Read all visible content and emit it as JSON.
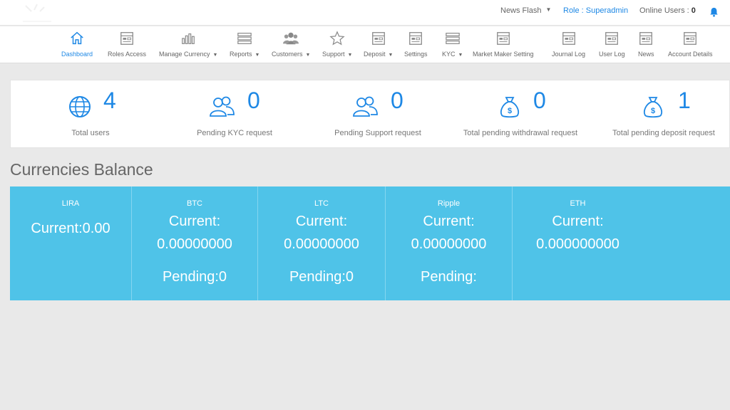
{
  "topbar": {
    "news_flash": "News Flash",
    "role": "Role : Superadmin",
    "online_label": "Online Users : ",
    "online_count": "0"
  },
  "nav": [
    {
      "label": "Dashboard",
      "icon": "home-icon",
      "dropdown": false,
      "active": true
    },
    {
      "label": "Roles Access",
      "icon": "panel-icon",
      "dropdown": false
    },
    {
      "label": "Manage Currency",
      "icon": "bar-chart-icon",
      "dropdown": true
    },
    {
      "label": "Reports",
      "icon": "list-icon",
      "dropdown": true
    },
    {
      "label": "Customers",
      "icon": "users-icon",
      "dropdown": true
    },
    {
      "label": "Support",
      "icon": "star-icon",
      "dropdown": true
    },
    {
      "label": "Deposit",
      "icon": "panel-icon",
      "dropdown": true
    },
    {
      "label": "Settings",
      "icon": "panel-icon",
      "dropdown": false
    },
    {
      "label": "KYC",
      "icon": "list-icon",
      "dropdown": true
    },
    {
      "label": "Market Maker Setting",
      "icon": "panel-icon",
      "dropdown": false
    },
    {
      "label": "Journal Log",
      "icon": "panel-icon",
      "dropdown": false
    },
    {
      "label": "User Log",
      "icon": "panel-icon",
      "dropdown": false
    },
    {
      "label": "News",
      "icon": "panel-icon",
      "dropdown": false
    },
    {
      "label": "Account Details",
      "icon": "panel-icon",
      "dropdown": false
    }
  ],
  "stats": [
    {
      "count": "4",
      "label": "Total users",
      "icon": "globe-icon"
    },
    {
      "count": "0",
      "label": "Pending KYC request",
      "icon": "users-outline-icon"
    },
    {
      "count": "0",
      "label": "Pending Support request",
      "icon": "users-outline-icon"
    },
    {
      "count": "0",
      "label": "Total pending withdrawal request",
      "icon": "money-bag-icon"
    },
    {
      "count": "1",
      "label": "Total pending deposit request",
      "icon": "money-bag-icon"
    }
  ],
  "currencies_title": "Currencies Balance",
  "currencies": [
    {
      "name": "LIRA",
      "current_inline": "Current:0.00"
    },
    {
      "name": "BTC",
      "current_label": "Current:",
      "current_value": "0.00000000",
      "pending": "Pending:0"
    },
    {
      "name": "LTC",
      "current_label": "Current:",
      "current_value": "0.00000000",
      "pending": "Pending:0"
    },
    {
      "name": "Ripple",
      "current_label": "Current:",
      "current_value": "0.00000000",
      "pending": "Pending:"
    },
    {
      "name": "ETH",
      "current_label": "Current:",
      "current_value": "0.000000000"
    }
  ],
  "colors": {
    "accent": "#1e88e5",
    "panel": "#4fc3e8",
    "background": "#e9e9e9"
  }
}
